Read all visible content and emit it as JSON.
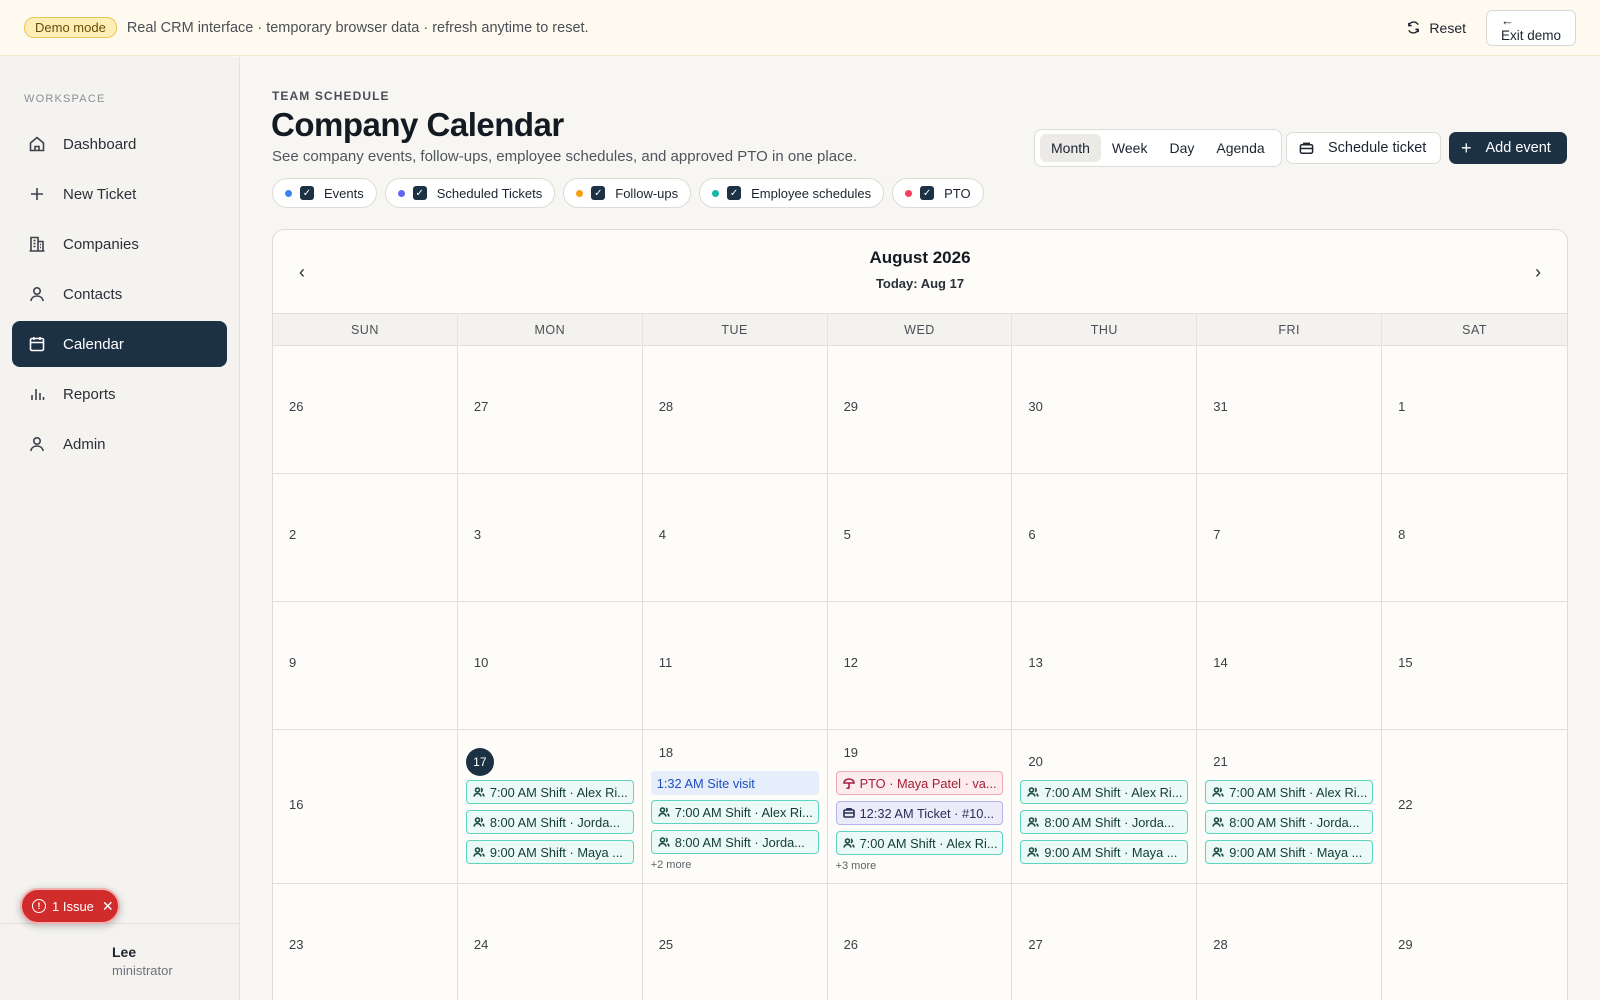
{
  "banner": {
    "badge": "Demo mode",
    "text": "Real CRM interface · temporary browser data · refresh anytime to reset.",
    "reset_label": "Reset",
    "exit_label": "Exit demo"
  },
  "sidebar": {
    "section_label": "WORKSPACE",
    "items": [
      {
        "label": "Dashboard",
        "icon": "home-icon"
      },
      {
        "label": "New Ticket",
        "icon": "plus-icon"
      },
      {
        "label": "Companies",
        "icon": "building-icon"
      },
      {
        "label": "Contacts",
        "icon": "person-icon"
      },
      {
        "label": "Calendar",
        "icon": "calendar-icon",
        "active": true
      },
      {
        "label": "Reports",
        "icon": "bar-chart-icon"
      },
      {
        "label": "Admin",
        "icon": "admin-icon"
      }
    ],
    "user": {
      "name": "Lee",
      "role": "ministrator"
    },
    "issue_label": "1 Issue"
  },
  "header": {
    "kicker": "TEAM SCHEDULE",
    "title": "Company Calendar",
    "subtitle": "See company events, follow-ups, employee schedules, and approved PTO in one place.",
    "views": [
      "Month",
      "Week",
      "Day",
      "Agenda"
    ],
    "active_view": "Month",
    "schedule_label": "Schedule ticket",
    "add_label": "Add event"
  },
  "filters": [
    {
      "label": "Events",
      "color": "#3b82f6"
    },
    {
      "label": "Scheduled Tickets",
      "color": "#6366f1"
    },
    {
      "label": "Follow-ups",
      "color": "#f59e0b"
    },
    {
      "label": "Employee schedules",
      "color": "#14b8a6"
    },
    {
      "label": "PTO",
      "color": "#f43f5e"
    }
  ],
  "calendar": {
    "month": "August 2026",
    "today": "Today: Aug 17",
    "weekdays": [
      "SUN",
      "MON",
      "TUE",
      "WED",
      "THU",
      "FRI",
      "SAT"
    ],
    "weeks": [
      [
        "26",
        "27",
        "28",
        "29",
        "30",
        "31",
        "1"
      ],
      [
        "2",
        "3",
        "4",
        "5",
        "6",
        "7",
        "8"
      ],
      [
        "9",
        "10",
        "11",
        "12",
        "13",
        "14",
        "15"
      ],
      [
        "16",
        "17",
        "18",
        "19",
        "20",
        "21",
        "22"
      ],
      [
        "23",
        "24",
        "25",
        "26",
        "27",
        "28",
        "29"
      ]
    ],
    "events": {
      "mon": [
        "7:00 AM Shift · Alex Ri...",
        "8:00 AM Shift · Jorda...",
        "9:00 AM Shift · Maya ..."
      ],
      "tue": [
        "1:32 AM Site visit",
        "7:00 AM Shift · Alex Ri...",
        "8:00 AM Shift · Jorda..."
      ],
      "tue_more": "+2 more",
      "wed": [
        "PTO · Maya Patel · va...",
        "12:32 AM Ticket · #10...",
        "7:00 AM Shift · Alex Ri..."
      ],
      "wed_more": "+3 more",
      "thu": [
        "7:00 AM Shift · Alex Ri...",
        "8:00 AM Shift · Jorda...",
        "9:00 AM Shift · Maya ..."
      ],
      "fri": [
        "7:00 AM Shift · Alex Ri...",
        "8:00 AM Shift · Jorda...",
        "9:00 AM Shift · Maya ..."
      ]
    }
  }
}
